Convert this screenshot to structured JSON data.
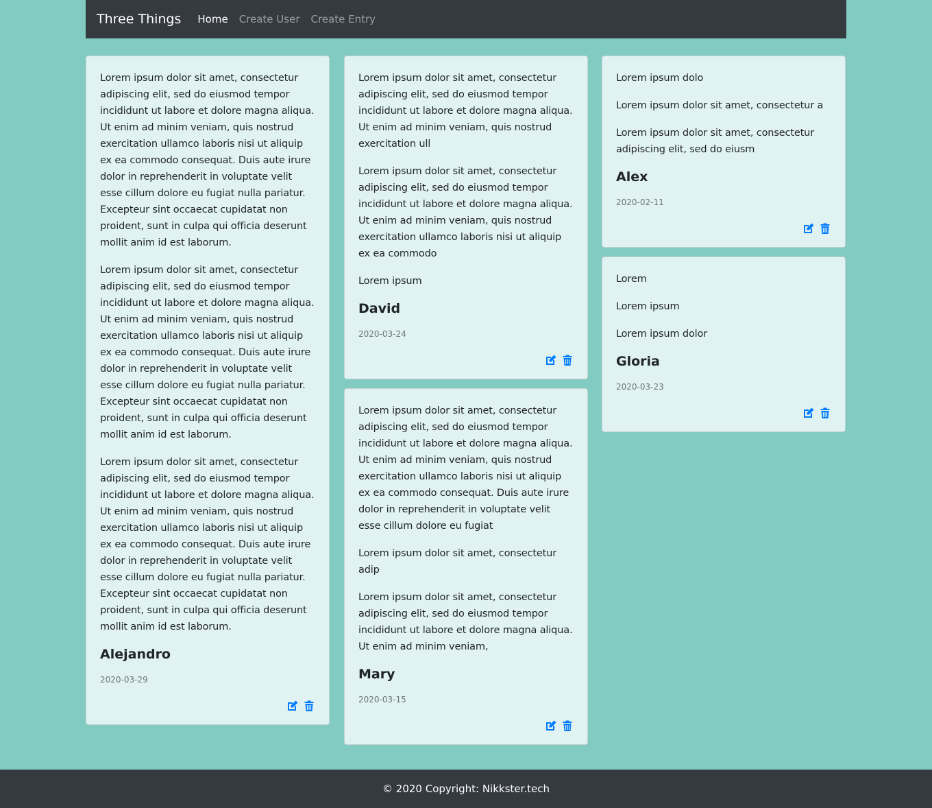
{
  "nav": {
    "brand": "Three Things",
    "links": [
      "Home",
      "Create User",
      "Create Entry"
    ]
  },
  "cards": [
    {
      "things": [
        "Lorem ipsum dolor sit amet, consectetur adipiscing elit, sed do eiusmod tempor incididunt ut labore et dolore magna aliqua. Ut enim ad minim veniam, quis nostrud exercitation ullamco laboris nisi ut aliquip ex ea commodo consequat. Duis aute irure dolor in reprehenderit in voluptate velit esse cillum dolore eu fugiat nulla pariatur. Excepteur sint occaecat cupidatat non proident, sunt in culpa qui officia deserunt mollit anim id est laborum.",
        "Lorem ipsum dolor sit amet, consectetur adipiscing elit, sed do eiusmod tempor incididunt ut labore et dolore magna aliqua. Ut enim ad minim veniam, quis nostrud exercitation ullamco laboris nisi ut aliquip ex ea commodo consequat. Duis aute irure dolor in reprehenderit in voluptate velit esse cillum dolore eu fugiat nulla pariatur. Excepteur sint occaecat cupidatat non proident, sunt in culpa qui officia deserunt mollit anim id est laborum.",
        "Lorem ipsum dolor sit amet, consectetur adipiscing elit, sed do eiusmod tempor incididunt ut labore et dolore magna aliqua. Ut enim ad minim veniam, quis nostrud exercitation ullamco laboris nisi ut aliquip ex ea commodo consequat. Duis aute irure dolor in reprehenderit in voluptate velit esse cillum dolore eu fugiat nulla pariatur. Excepteur sint occaecat cupidatat non proident, sunt in culpa qui officia deserunt mollit anim id est laborum."
      ],
      "name": "Alejandro",
      "date": "2020-03-29"
    },
    {
      "things": [
        "Lorem ipsum dolor sit amet, consectetur adipiscing elit, sed do eiusmod tempor incididunt ut labore et dolore magna aliqua. Ut enim ad minim veniam, quis nostrud exercitation ull",
        "Lorem ipsum dolor sit amet, consectetur adipiscing elit, sed do eiusmod tempor incididunt ut labore et dolore magna aliqua. Ut enim ad minim veniam, quis nostrud exercitation ullamco laboris nisi ut aliquip ex ea commodo",
        "Lorem ipsum"
      ],
      "name": "David",
      "date": "2020-03-24"
    },
    {
      "things": [
        "Lorem ipsum dolor sit amet, consectetur adipiscing elit, sed do eiusmod tempor incididunt ut labore et dolore magna aliqua. Ut enim ad minim veniam, quis nostrud exercitation ullamco laboris nisi ut aliquip ex ea commodo consequat. Duis aute irure dolor in reprehenderit in voluptate velit esse cillum dolore eu fugiat",
        "Lorem ipsum dolor sit amet, consectetur adip",
        "Lorem ipsum dolor sit amet, consectetur adipiscing elit, sed do eiusmod tempor incididunt ut labore et dolore magna aliqua. Ut enim ad minim veniam,"
      ],
      "name": "Mary",
      "date": "2020-03-15"
    },
    {
      "things": [
        "Lorem ipsum dolo",
        "Lorem ipsum dolor sit amet, consectetur a",
        "Lorem ipsum dolor sit amet, consectetur adipiscing elit, sed do eiusm"
      ],
      "name": "Alex",
      "date": "2020-02-11"
    },
    {
      "things": [
        "Lorem",
        "Lorem ipsum",
        "Lorem ipsum dolor"
      ],
      "name": "Gloria",
      "date": "2020-03-23"
    }
  ],
  "icons": {
    "edit": "edit-icon",
    "delete": "trash-icon"
  },
  "colors": {
    "accent": "#007bff",
    "navbar": "#343a40",
    "background": "#81cbc3",
    "card": "#e0f2f1"
  },
  "footer": {
    "text": "© 2020 Copyright: Nikkster.tech"
  }
}
